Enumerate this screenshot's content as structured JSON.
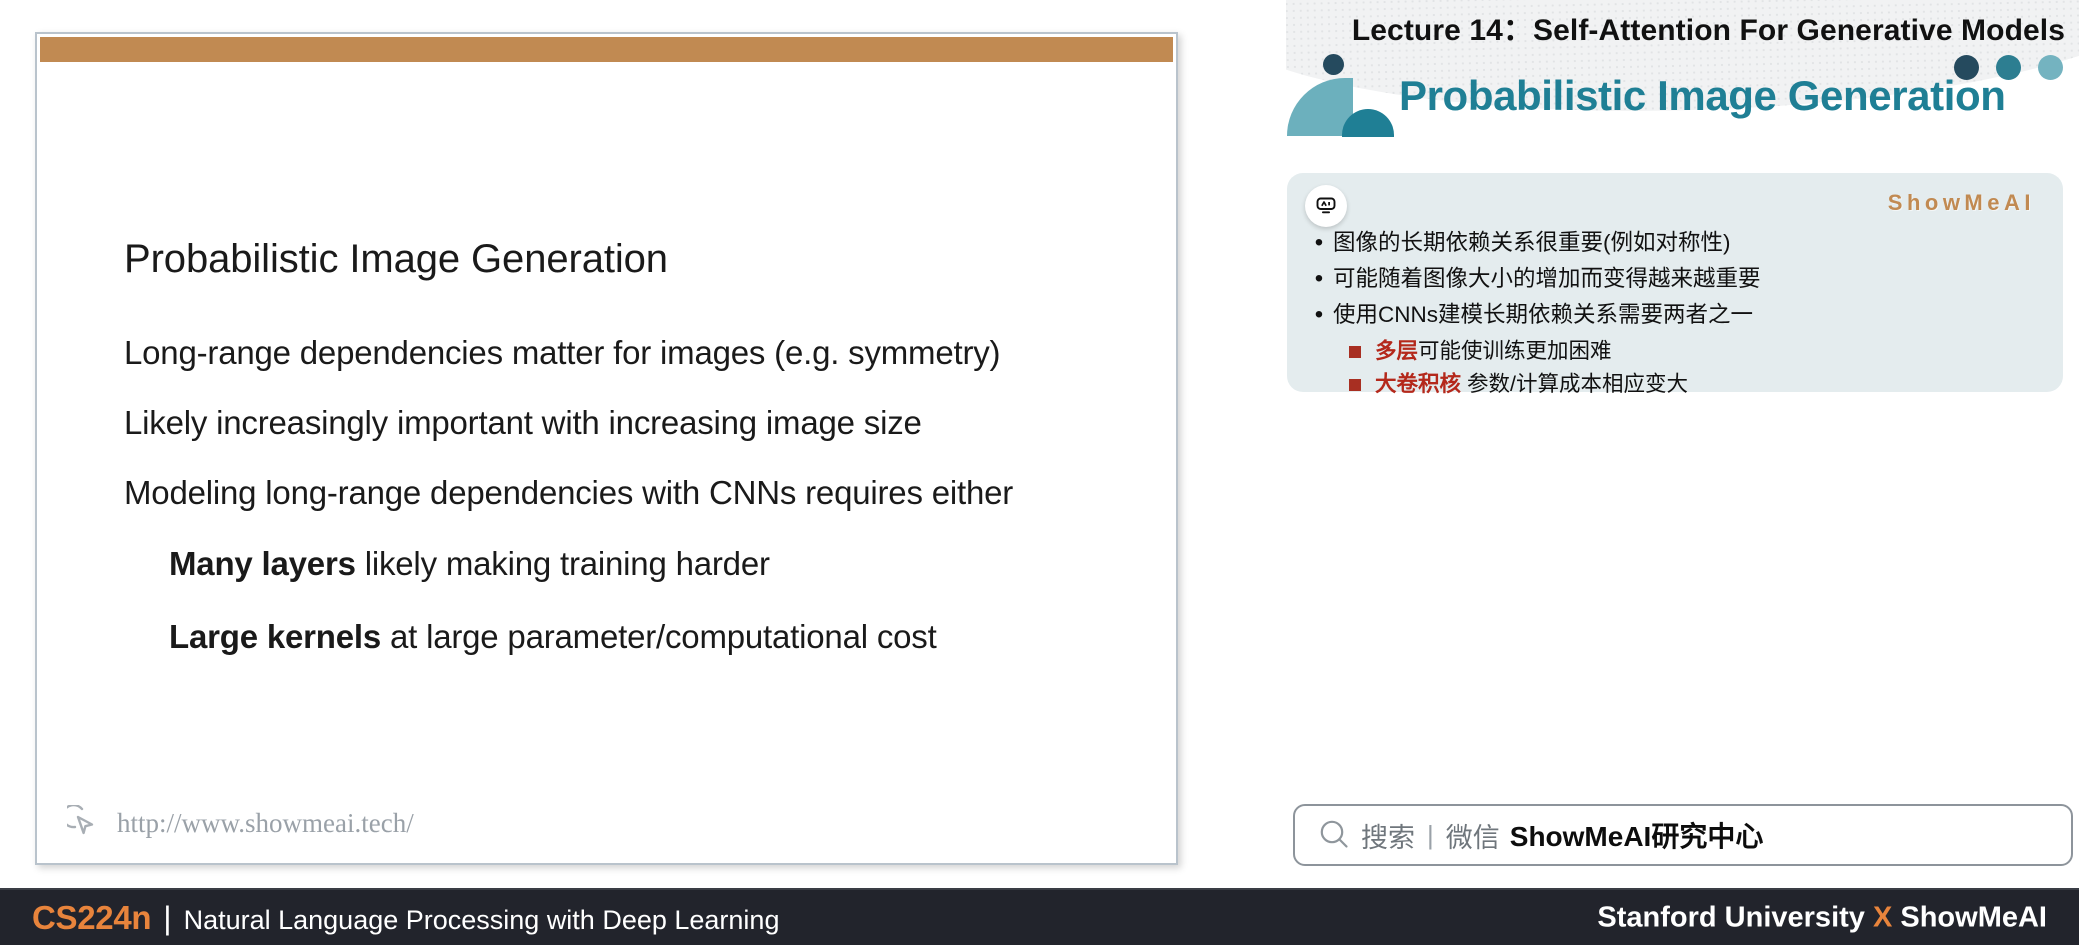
{
  "lecture": {
    "header_title": "Lecture 14：Self-Attention For Generative Models",
    "section_title": "Probabilistic Image Generation"
  },
  "slide": {
    "title": "Probabilistic Image Generation",
    "lines": [
      "Long-range dependencies matter for images (e.g. symmetry)",
      "Likely increasingly important with increasing image size",
      "Modeling long-range dependencies with CNNs requires either"
    ],
    "sub_lines": [
      {
        "bold": "Many layers",
        "rest": " likely making training harder"
      },
      {
        "bold": "Large kernels",
        "rest": " at large parameter/computational cost"
      }
    ],
    "watermark": "http://www.showmeai.tech/",
    "watermark_icon": "cursor-arrow-icon",
    "topbar_color": "#c18a52"
  },
  "note_card": {
    "badge_icon": "ai-robot-icon",
    "brand": "ShowMeAI",
    "brand_color": "#c18a52",
    "background": "#e4ecee",
    "bullets": [
      {
        "marker": "•",
        "text": "图像的长期依赖关系很重要(例如对称性)"
      },
      {
        "marker": "•",
        "text": "可能随着图像大小的增加而变得越来越重要"
      },
      {
        "marker": "•",
        "text": "使用CNNs建模长期依赖关系需要两者之一"
      }
    ],
    "sub_bullets": [
      {
        "marker": "square",
        "highlight": "多层",
        "rest": "可能使训练更加困难"
      },
      {
        "marker": "square",
        "highlight": "大卷积核",
        "rest": " 参数/计算成本相应变大"
      }
    ],
    "highlight_color": "#b4281b"
  },
  "search": {
    "icon": "search-icon",
    "placeholder": "搜索",
    "separator": "|",
    "channel": "微信",
    "brand": "ShowMeAI研究中心"
  },
  "footer": {
    "course_code": "CS224n",
    "divider": "|",
    "course_name": "Natural Language Processing with Deep Learning",
    "org_left": "Stanford University",
    "org_x": "X",
    "org_right": "ShowMeAI",
    "accent_color": "#e8843c",
    "background": "#22242c"
  },
  "logo": {
    "dots": [
      "#254a5e",
      "#2d7e91",
      "#74b3c0"
    ],
    "mark_colors": [
      "#6cb0bd",
      "#1f7f95",
      "#254a5e"
    ],
    "title_color": "#1f7f95"
  }
}
